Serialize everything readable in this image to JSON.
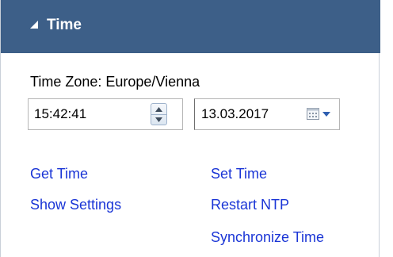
{
  "panel": {
    "title": "Time",
    "toggle_icon": "collapse-triangle-icon",
    "colors": {
      "header_bg": "#3d5f88",
      "header_text": "#ffffff",
      "link": "#1a35d6"
    }
  },
  "timezone": {
    "label": "Time Zone: Europe/Vienna"
  },
  "time_field": {
    "value": "15:42:41",
    "spinner_icons": [
      "spinner-up-icon",
      "spinner-down-icon"
    ]
  },
  "date_field": {
    "value": "13.03.2017",
    "picker_icon": "calendar-dropdown-icon"
  },
  "links": {
    "get_time": "Get Time",
    "set_time": "Set Time",
    "show_settings": "Show Settings",
    "restart_ntp": "Restart NTP",
    "synchronize_time": "Synchronize Time"
  }
}
